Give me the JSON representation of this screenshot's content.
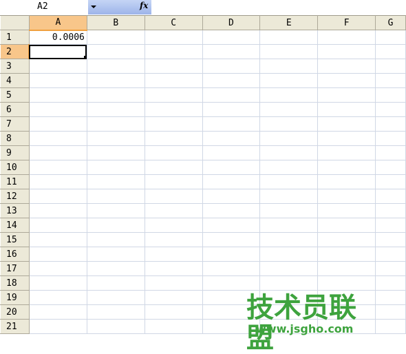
{
  "formula_bar": {
    "name_box": "A2",
    "fx_label": "fx",
    "formula": ""
  },
  "sheet": {
    "columns": [
      "A",
      "B",
      "C",
      "D",
      "E",
      "F",
      "G"
    ],
    "active_column": "A",
    "active_row": "2",
    "rows": [
      {
        "num": "1",
        "a": "0.0006"
      },
      {
        "num": "2",
        "a": ""
      },
      {
        "num": "3",
        "a": ""
      },
      {
        "num": "4",
        "a": ""
      },
      {
        "num": "5",
        "a": ""
      },
      {
        "num": "6",
        "a": ""
      },
      {
        "num": "7",
        "a": ""
      },
      {
        "num": "8",
        "a": ""
      },
      {
        "num": "9",
        "a": ""
      },
      {
        "num": "10",
        "a": ""
      },
      {
        "num": "11",
        "a": ""
      },
      {
        "num": "12",
        "a": ""
      },
      {
        "num": "13",
        "a": ""
      },
      {
        "num": "14",
        "a": ""
      },
      {
        "num": "15",
        "a": ""
      },
      {
        "num": "16",
        "a": ""
      },
      {
        "num": "17",
        "a": ""
      },
      {
        "num": "18",
        "a": ""
      },
      {
        "num": "19",
        "a": ""
      },
      {
        "num": "20",
        "a": ""
      },
      {
        "num": "21",
        "a": ""
      }
    ]
  },
  "watermark": {
    "title": "技术员联盟",
    "url": "www.jsgho.com",
    "color": "#3ea33e"
  }
}
